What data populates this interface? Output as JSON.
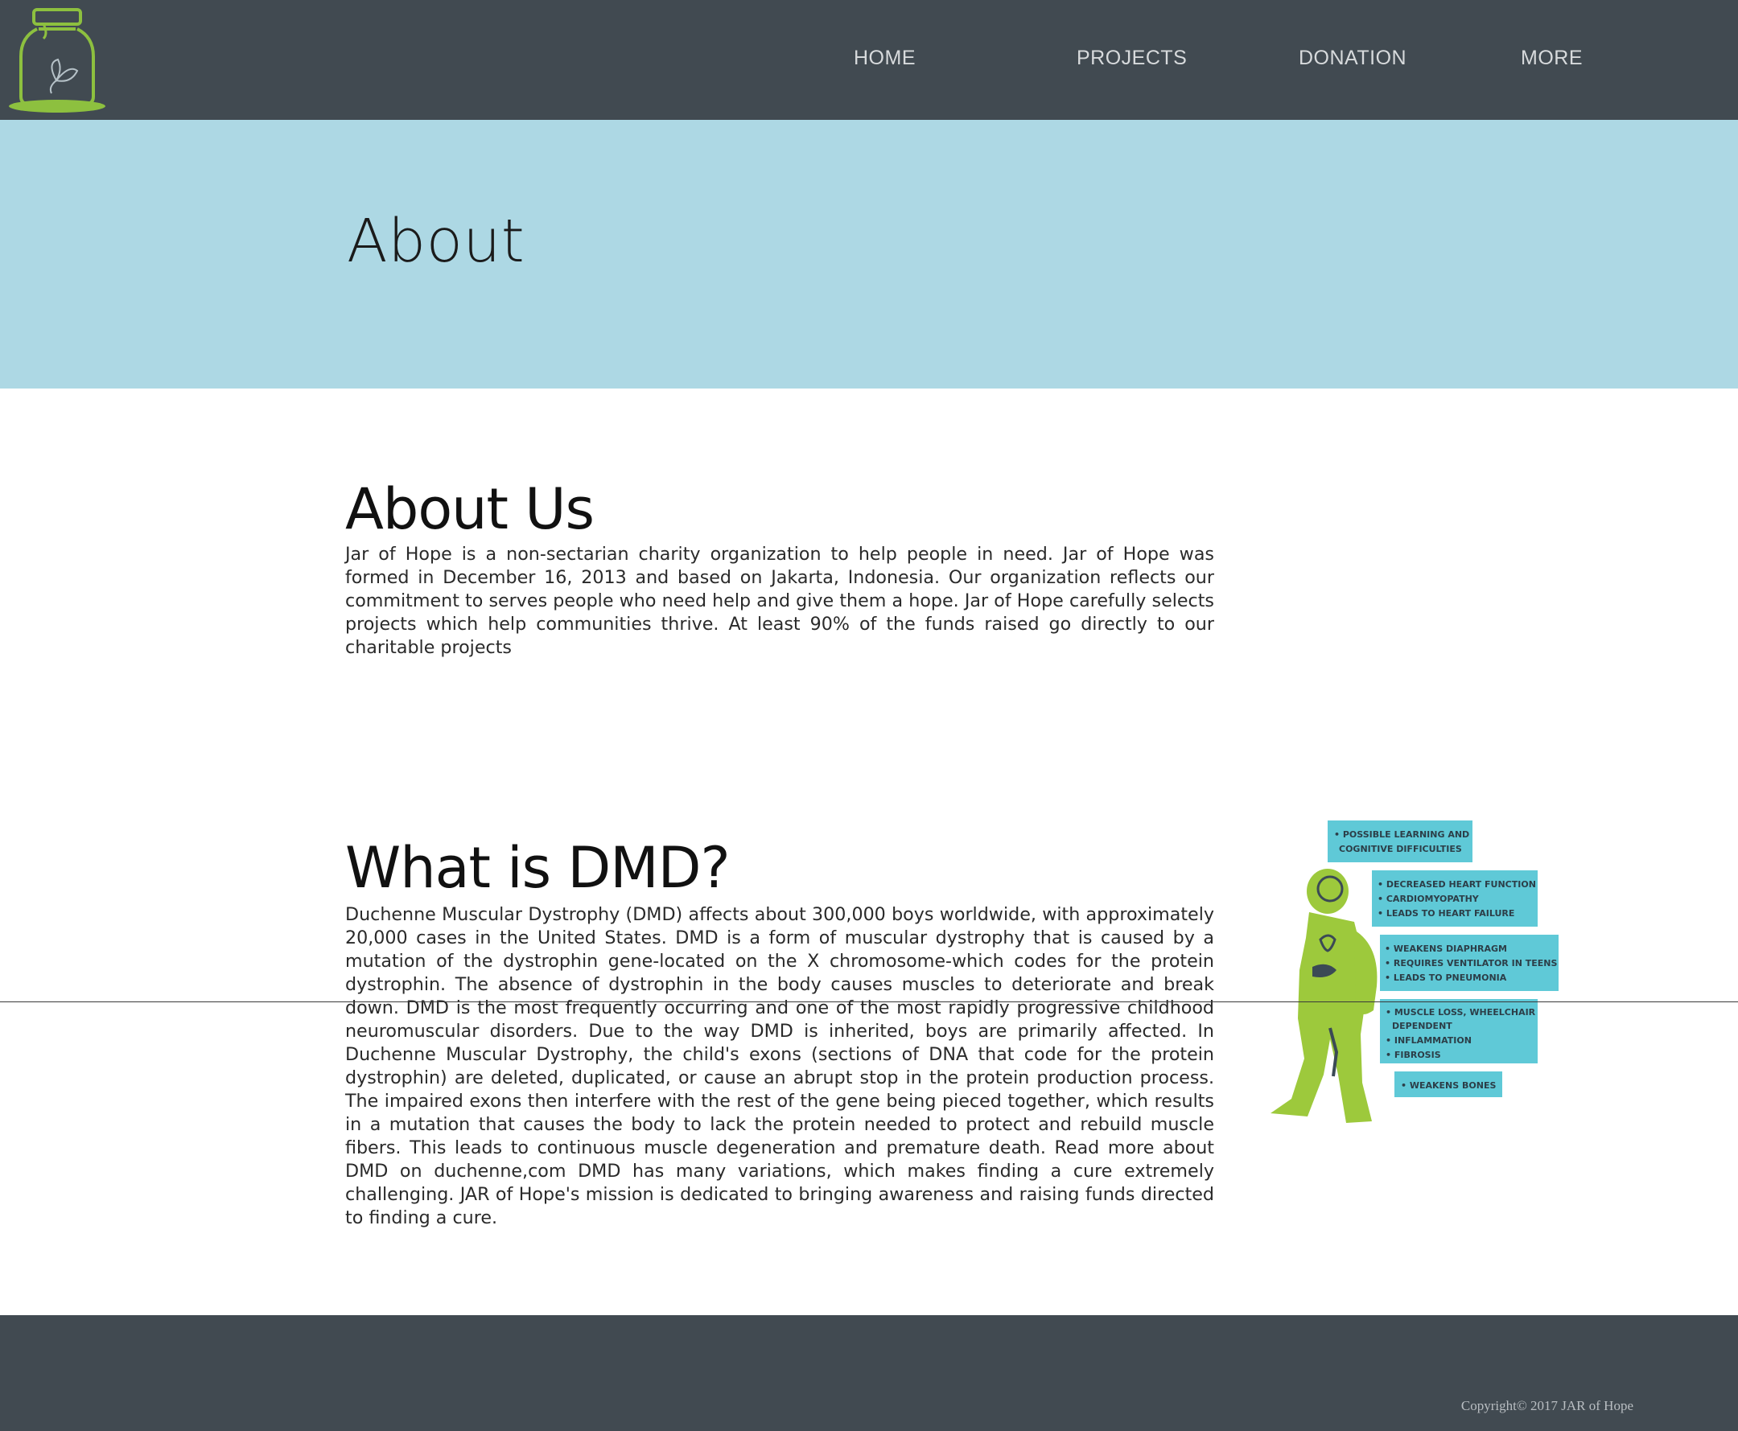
{
  "nav": {
    "logo_icon": "jar-butterfly-logo-icon",
    "items": [
      {
        "label": "HOME"
      },
      {
        "label": "PROJECTS"
      },
      {
        "label": "DONATION"
      },
      {
        "label": "MORE"
      }
    ]
  },
  "hero": {
    "title": "About"
  },
  "about": {
    "title": "About Us",
    "text": "Jar of Hope is a non-sectarian charity organization to help people in need. Jar of Hope was formed in December 16, 2013 and based on Jakarta, Indonesia. Our organization reflects our commitment to serves people who need help and give them a hope. Jar of Hope carefully selects projects which help communities thrive. At least 90% of the funds raised go directly to our charitable projects"
  },
  "dmd": {
    "title": "What is DMD?",
    "text": "Duchenne Muscular Dystrophy (DMD) affects about 300,000 boys worldwide, with approximately 20,000 cases in the United States. DMD is a form of muscular dystrophy that is caused by a mutation of the dystrophin gene-located on the X chromosome-which codes for the protein dystrophin. The absence of dystrophin in the body causes muscles to deteriorate and break down. DMD is the most frequently occurring and one of the most rapidly progressive childhood neuromuscular disorders. Due to the way DMD is inherited, boys are primarily affected. In Duchenne Muscular Dystrophy, the child's exons (sections of DNA that code for the protein dystrophin) are deleted, duplicated, or cause an abrupt stop in the protein production process. The impaired exons then interfere with the rest of the gene being pieced together, which results in a mutation that causes the body to lack the protein needed to protect and rebuild muscle fibers. This leads to continuous muscle degeneration and premature death. Read more about DMD on duchenne,com DMD has many variations, which makes finding a cure extremely challenging. JAR of Hope's mission is dedicated to bringing awareness and raising funds directed to finding a cure.",
    "figure_labels": [
      {
        "lines": [
          "• POSSIBLE LEARNING AND",
          "COGNITIVE DIFFICULTIES"
        ]
      },
      {
        "lines": [
          "• DECREASED HEART FUNCTION",
          "• CARDIOMYOPATHY",
          "• LEADS TO HEART FAILURE"
        ]
      },
      {
        "lines": [
          "• WEAKENS DIAPHRAGM",
          "• REQUIRES VENTILATOR IN TEENS",
          "• LEADS TO PNEUMONIA"
        ]
      },
      {
        "lines": [
          "• MUSCLE LOSS, WHEELCHAIR",
          "DEPENDENT",
          "• INFLAMMATION",
          "• FIBROSIS"
        ]
      },
      {
        "lines": [
          "• WEAKENS BONES"
        ]
      }
    ]
  },
  "footer": {
    "copyright": "Copyright© 2017 JAR of Hope"
  },
  "colors": {
    "navbar": "#414a51",
    "hero": "#add8e4",
    "logo_green": "#8dc03f",
    "label_blue": "#5fc9d7",
    "figure_green": "#9dc93c"
  }
}
